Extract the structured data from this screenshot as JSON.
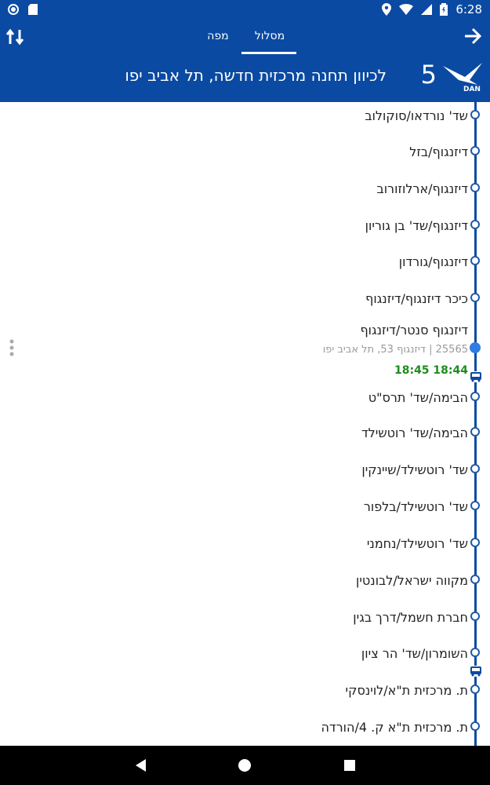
{
  "status": {
    "time": "6:28"
  },
  "header": {
    "tabs": [
      {
        "label": "מפה"
      },
      {
        "label": "מסלול"
      }
    ],
    "route_number": "5",
    "direction_title": "לכיוון תחנה מרכזית חדשה, תל אביב יפו",
    "logo_text": "DAN"
  },
  "stops": [
    {
      "name": "שד' נורדאו/סוקולוב"
    },
    {
      "name": "דיזנגוף/בזל"
    },
    {
      "name": "דיזנגוף/ארלוזורוב"
    },
    {
      "name": "דיזנגוף/שד' בן גוריון"
    },
    {
      "name": "דיזנגוף/גורדון"
    },
    {
      "name": "כיכר דיזנגוף/דיזנגוף"
    },
    {
      "name": "דיזנגוף סנטר/דיזנגוף"
    },
    {
      "name": "הבימה/שד' תרס\"ט"
    },
    {
      "name": "הבימה/שד' רוטשילד"
    },
    {
      "name": "שד' רוטשילד/שיינקין"
    },
    {
      "name": "שד' רוטשילד/בלפור"
    },
    {
      "name": "שד' רוטשילד/נחמני"
    },
    {
      "name": "מקווה ישראל/לבונטין"
    },
    {
      "name": "חברת חשמל/דרך בגין"
    },
    {
      "name": "השומרון/שד' הר ציון"
    },
    {
      "name": "ת. מרכזית ת\"א/לוינסקי"
    },
    {
      "name": "ת. מרכזית ת\"א ק. 4/הורדה"
    }
  ],
  "selected_stop": {
    "detail": "25565 | דיזנגוף 53, תל אביב יפו",
    "eta": "18:45  18:44"
  },
  "colors": {
    "primary": "#0b4aa2",
    "accent": "#2f7de3",
    "eta": "#1c8d1c"
  }
}
